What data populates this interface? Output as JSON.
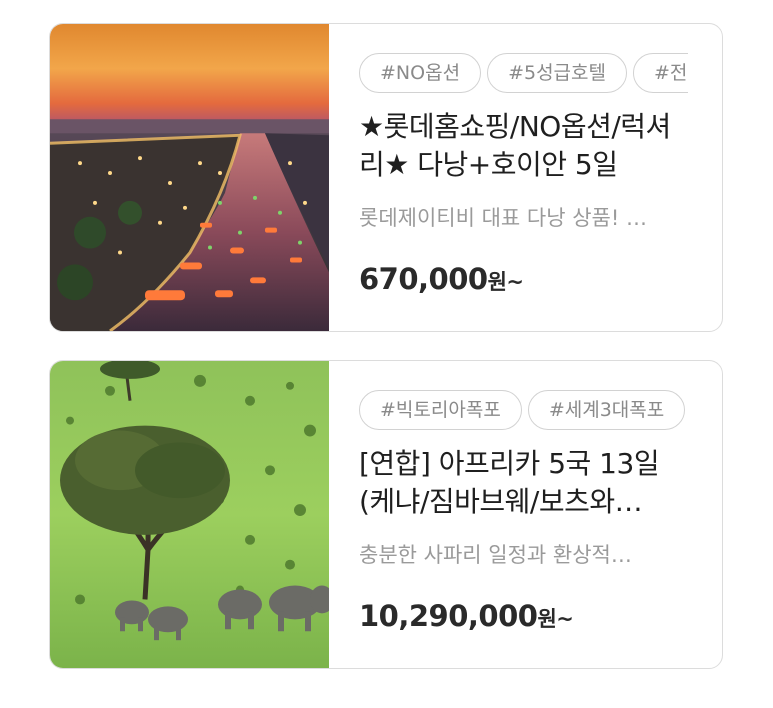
{
  "products": [
    {
      "image_alt": "호이안 야경 강과 등불 배",
      "tags": [
        "#NO옵션",
        "#5성급호텔",
        "#전"
      ],
      "title": "★롯데홈쇼핑/NO옵션/럭셔리★ 다낭+호이안 5일",
      "description": "롯데제이티비 대표 다낭 상품! …",
      "price": "670,000",
      "price_unit": "원~"
    },
    {
      "image_alt": "사바나 초원과 코끼리 무리",
      "tags": [
        "#빅토리아폭포",
        "#세계3대폭포"
      ],
      "title": "[연합] 아프리카 5국 13일 (케냐/짐바브웨/보츠와…",
      "description": "충분한 사파리 일정과 환상적…",
      "price": "10,290,000",
      "price_unit": "원~"
    }
  ]
}
